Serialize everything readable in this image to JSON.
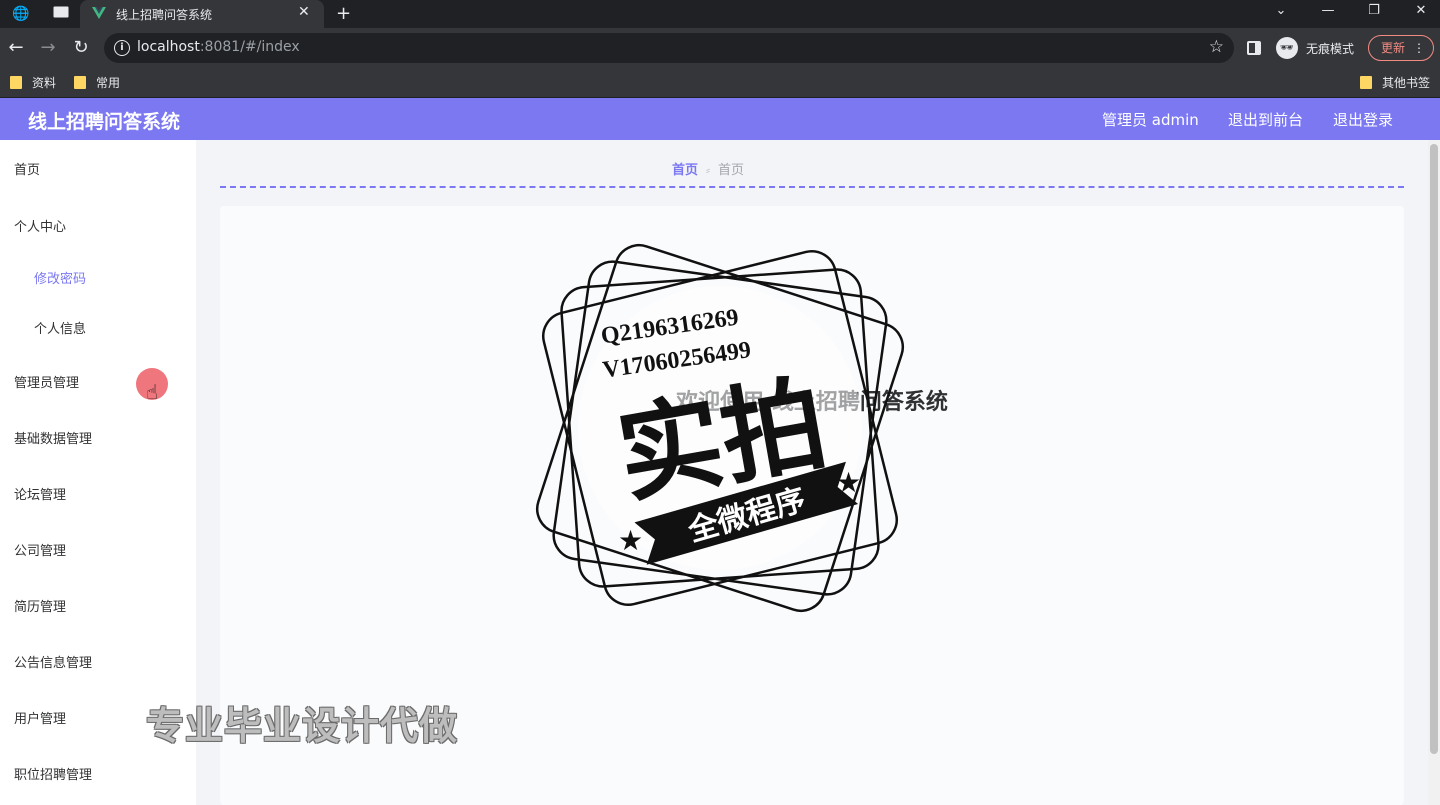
{
  "browser": {
    "tab_title": "线上招聘问答系统",
    "url_host": "localhost",
    "url_rest": ":8081/#/index",
    "incognito_label": "无痕模式",
    "update_label": "更新",
    "bookmarks": [
      "资料",
      "常用"
    ],
    "other_bookmarks": "其他书签"
  },
  "header": {
    "title": "线上招聘问答系统",
    "user": "管理员 admin",
    "to_front": "退出到前台",
    "logout": "退出登录",
    "color": "#7b78f2"
  },
  "sidebar": {
    "items": [
      {
        "label": "首页"
      },
      {
        "label": "个人中心"
      },
      {
        "label": "修改密码"
      },
      {
        "label": "个人信息"
      },
      {
        "label": "管理员管理"
      },
      {
        "label": "基础数据管理"
      },
      {
        "label": "论坛管理"
      },
      {
        "label": "公司管理"
      },
      {
        "label": "简历管理"
      },
      {
        "label": "公告信息管理"
      },
      {
        "label": "用户管理"
      },
      {
        "label": "职位招聘管理"
      }
    ]
  },
  "main": {
    "breadcrumb_home": "首页",
    "breadcrumb_current": "首页",
    "welcome": "欢迎使用 线上招聘问答系统"
  },
  "overlay": {
    "stamp_line1": "Q2196316269",
    "stamp_line2": "V17060256499",
    "stamp_big": "实拍",
    "stamp_ribbon": "全微程序",
    "promo": "专业毕业设计代做"
  }
}
